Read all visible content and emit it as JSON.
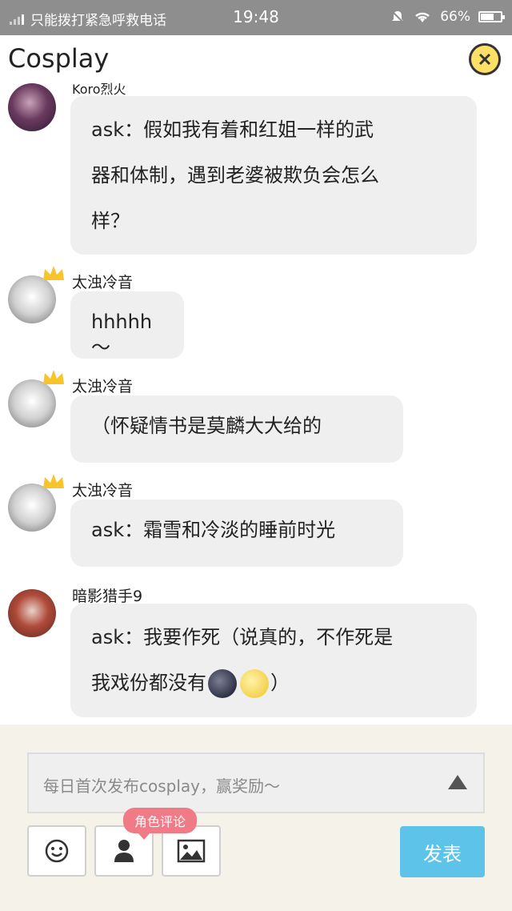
{
  "status_bar": {
    "carrier": "只能拨打紧急呼救电话",
    "time": "19:48",
    "battery": "66%",
    "battery_level": 0.66
  },
  "header": {
    "title": "Cosplay",
    "close_icon": "close-icon"
  },
  "messages": [
    {
      "username": "Koro烈火",
      "text_lines": [
        "ask：假如我有着和红姐一样的武",
        "器和体制，遇到老婆被欺负会怎么",
        "样？"
      ],
      "crown": false,
      "avatar_color": "#5a2a4a"
    },
    {
      "username": "太浊冷音",
      "text": "hhhhh～",
      "crown": true,
      "avatar_color": "#d6d6d6"
    },
    {
      "username": "太浊冷音",
      "text": "（怀疑情书是莫麟大大给的",
      "crown": true,
      "avatar_color": "#d6d6d6"
    },
    {
      "username": "太浊冷音",
      "text": "ask：霜雪和冷淡的睡前时光",
      "crown": true,
      "avatar_color": "#d6d6d6"
    },
    {
      "username": "暗影猎手9",
      "text_lines": [
        "ask：我要作死（说真的，不作死是",
        "我戏份都没有"
      ],
      "line2_suffix": "）",
      "emojis": [
        "new-moon-face",
        "full-moon-face"
      ],
      "crown": false,
      "avatar_color": "#8a3a2a"
    }
  ],
  "composer": {
    "placeholder": "每日首次发布cosplay，赢奖励～",
    "badge": "角色评论",
    "publish": "发表",
    "tools": [
      "smiley-icon",
      "person-icon",
      "image-icon"
    ]
  }
}
